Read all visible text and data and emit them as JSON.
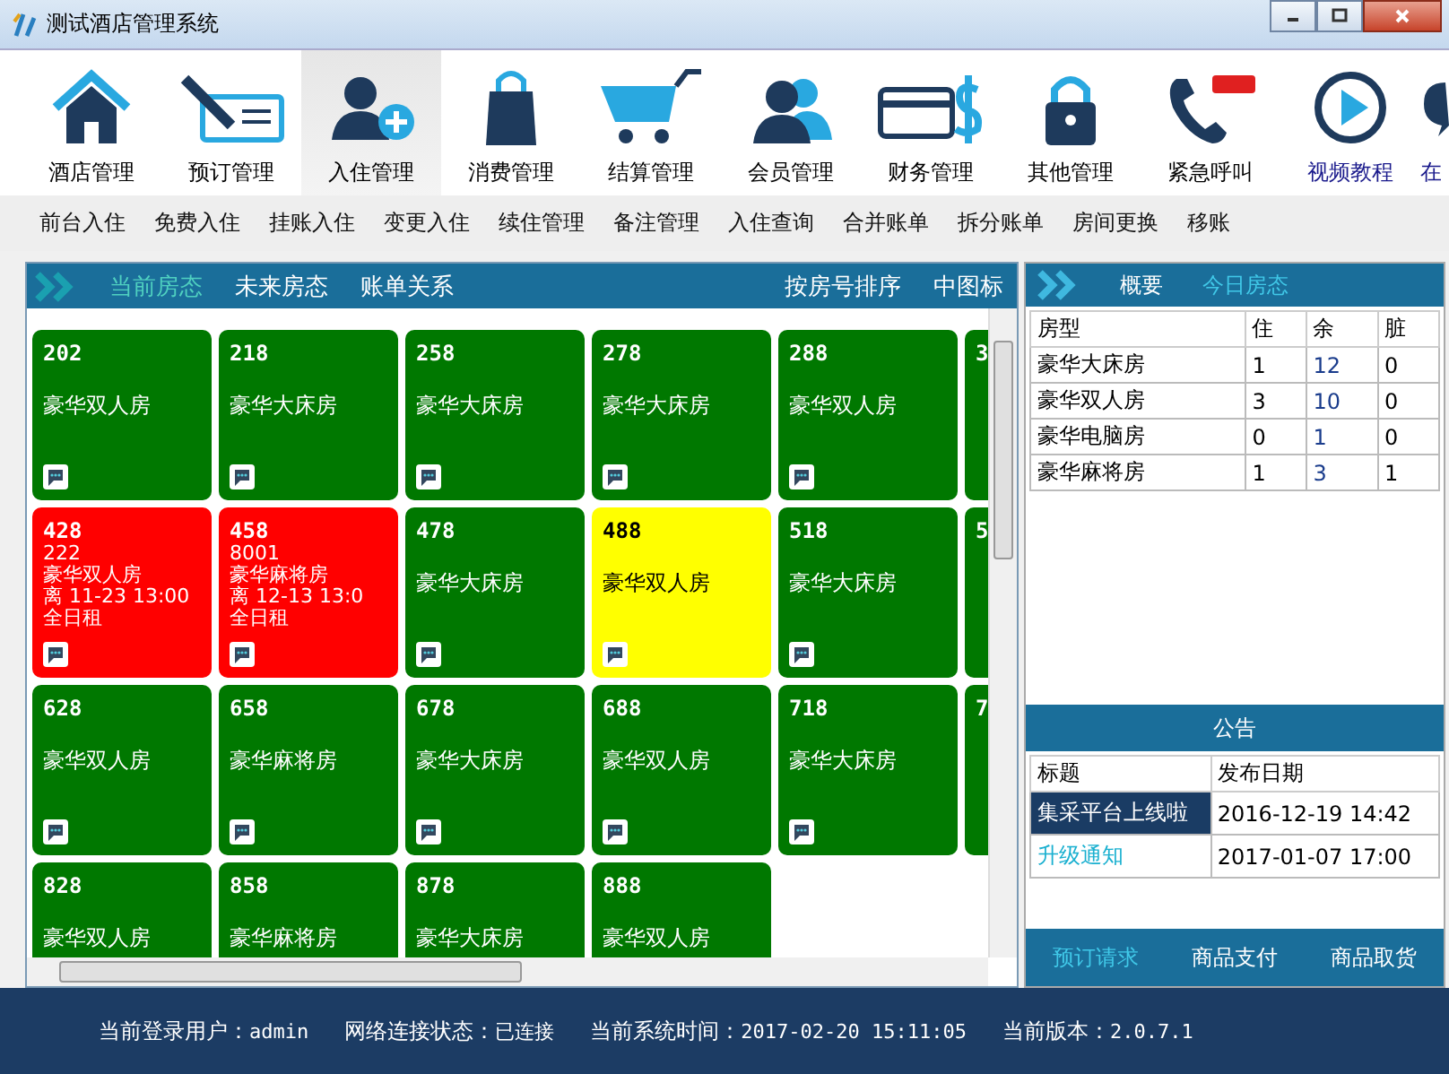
{
  "window": {
    "title": "测试酒店管理系统"
  },
  "toolbar": [
    {
      "label": "酒店管理",
      "selected": false,
      "kind": "module"
    },
    {
      "label": "预订管理",
      "selected": false,
      "kind": "module"
    },
    {
      "label": "入住管理",
      "selected": true,
      "kind": "module"
    },
    {
      "label": "消费管理",
      "selected": false,
      "kind": "module"
    },
    {
      "label": "结算管理",
      "selected": false,
      "kind": "module"
    },
    {
      "label": "会员管理",
      "selected": false,
      "kind": "module"
    },
    {
      "label": "财务管理",
      "selected": false,
      "kind": "module"
    },
    {
      "label": "其他管理",
      "selected": false,
      "kind": "module"
    },
    {
      "label": "紧急呼叫",
      "selected": false,
      "kind": "module"
    },
    {
      "label": "视频教程",
      "selected": false,
      "kind": "link"
    },
    {
      "label": "在",
      "selected": false,
      "kind": "link"
    }
  ],
  "submenu": [
    "前台入住",
    "免费入住",
    "挂账入住",
    "变更入住",
    "续住管理",
    "备注管理",
    "入住查询",
    "合并账单",
    "拆分账单",
    "房间更换",
    "移账"
  ],
  "room_panel": {
    "tabs": [
      {
        "label": "当前房态",
        "selected": true
      },
      {
        "label": "未来房态",
        "selected": false
      },
      {
        "label": "账单关系",
        "selected": false
      }
    ],
    "actions": [
      "按房号排序",
      "中图标"
    ],
    "rooms": [
      {
        "number": "202",
        "type": "豪华双人房",
        "color": "#007800",
        "note": true
      },
      {
        "number": "218",
        "type": "豪华大床房",
        "color": "#007800",
        "note": true
      },
      {
        "number": "258",
        "type": "豪华大床房",
        "color": "#007800",
        "note": true
      },
      {
        "number": "278",
        "type": "豪华大床房",
        "color": "#007800",
        "note": true
      },
      {
        "number": "288",
        "type": "豪华双人房",
        "color": "#007800",
        "note": true
      },
      {
        "number": "3",
        "color": "#007800"
      },
      {
        "number": "428",
        "guest": "222",
        "type": "豪华双人房",
        "departure": "离 11-23 13:00",
        "rate": "全日租",
        "color": "#ff0000",
        "note": true
      },
      {
        "number": "458",
        "guest": "8001",
        "type": "豪华麻将房",
        "departure": "离 12-13 13:0",
        "rate": "全日租",
        "color": "#ff0000",
        "note": true
      },
      {
        "number": "478",
        "type": "豪华大床房",
        "color": "#007800",
        "note": true
      },
      {
        "number": "488",
        "type": "豪华双人房",
        "color": "#ffff00",
        "note": true
      },
      {
        "number": "518",
        "type": "豪华大床房",
        "color": "#007800",
        "note": true
      },
      {
        "number": "5",
        "color": "#007800"
      },
      {
        "number": "628",
        "type": "豪华双人房",
        "color": "#007800",
        "note": true
      },
      {
        "number": "658",
        "type": "豪华麻将房",
        "color": "#007800",
        "note": true
      },
      {
        "number": "678",
        "type": "豪华大床房",
        "color": "#007800",
        "note": true
      },
      {
        "number": "688",
        "type": "豪华双人房",
        "color": "#007800",
        "note": true
      },
      {
        "number": "718",
        "type": "豪华大床房",
        "color": "#007800",
        "note": true
      },
      {
        "number": "7",
        "color": "#007800"
      },
      {
        "number": "828",
        "type": "豪华双人房",
        "color": "#007800"
      },
      {
        "number": "858",
        "type": "豪华麻将房",
        "color": "#007800"
      },
      {
        "number": "878",
        "type": "豪华大床房",
        "color": "#007800"
      },
      {
        "number": "888",
        "type": "豪华双人房",
        "color": "#007800"
      }
    ]
  },
  "summary": {
    "tabs": [
      {
        "label": "概要",
        "selected": false
      },
      {
        "label": "今日房态",
        "selected": true
      }
    ],
    "columns": [
      "房型",
      "住",
      "余",
      "脏"
    ],
    "rows": [
      [
        "豪华大床房",
        "1",
        "12",
        "0"
      ],
      [
        "豪华双人房",
        "3",
        "10",
        "0"
      ],
      [
        "豪华电脑房",
        "0",
        "1",
        "0"
      ],
      [
        "豪华麻将房",
        "1",
        "3",
        "1"
      ]
    ]
  },
  "notices": {
    "title": "公告",
    "columns": [
      "标题",
      "发布日期"
    ],
    "rows": [
      {
        "title": "集采平台上线啦",
        "date": "2016-12-19 14:42",
        "selected": true
      },
      {
        "title": "升级通知",
        "date": "2017-01-07 17:00",
        "selected": false
      }
    ]
  },
  "bottom_tabs": [
    {
      "label": "预订请求",
      "selected": true
    },
    {
      "label": "商品支付",
      "selected": false
    },
    {
      "label": "商品取货",
      "selected": false
    }
  ],
  "status_bar": [
    {
      "label": "当前登录用户：",
      "value": "admin"
    },
    {
      "label": "网络连接状态：",
      "value": "已连接"
    },
    {
      "label": "当前系统时间：",
      "value": "2017-02-20 15:11:05"
    },
    {
      "label": "当前版本：",
      "value": "2.0.7.1"
    }
  ]
}
